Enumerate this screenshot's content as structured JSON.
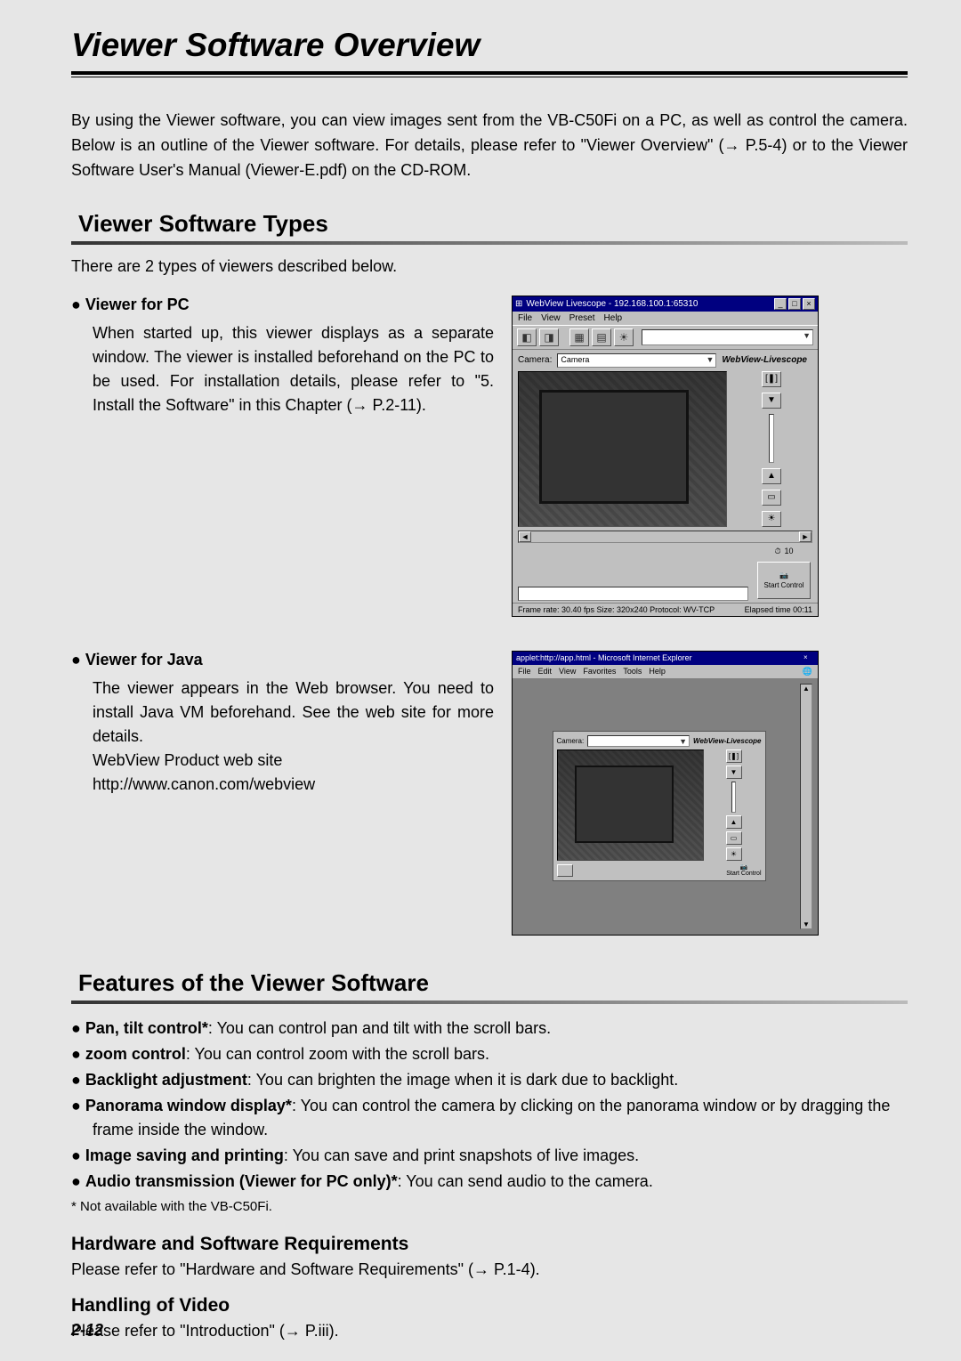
{
  "title": "Viewer Software Overview",
  "intro": "By using the Viewer software, you can view images sent from the VB-C50Fi on a PC, as well as control the camera. Below is an outline of the Viewer software. For details, please refer to \"Viewer Overview\" (→ P.5-4) or to the Viewer Software User's Manual (Viewer-E.pdf) on the CD-ROM.",
  "section_types": "Viewer Software Types",
  "types_intro": "There are 2 types of viewers described below.",
  "viewer_pc": {
    "head": "Viewer for PC",
    "body": "When started up, this viewer displays as a separate window. The viewer is installed beforehand on the PC to be used. For installation details, please refer to \"5. Install the Software\" in this Chapter (→ P.2-11)."
  },
  "viewer_java": {
    "head": "Viewer for Java",
    "body": "The viewer appears in the Web browser. You need to install Java VM beforehand. See the web site for more details.",
    "site_label": "WebView Product web site",
    "site_url": "http://www.canon.com/webview"
  },
  "pc_app": {
    "title": "WebView Livescope - 192.168.100.1:65310",
    "menu": [
      "File",
      "View",
      "Preset",
      "Help"
    ],
    "camera_label": "Camera:",
    "camera_value": "Camera",
    "brand": "WebView-Livescope",
    "status_left": "Frame rate: 30.40 fps   Size: 320x240   Protocol: WV-TCP",
    "status_right": "Elapsed time 00:11",
    "start": "Start Control"
  },
  "java_app": {
    "title": "applet:http://app.html - Microsoft Internet Explorer",
    "menu": [
      "File",
      "Edit",
      "View",
      "Favorites",
      "Tools",
      "Help"
    ],
    "camera_label": "Camera:",
    "brand": "WebView-Livescope",
    "start": "Start Control"
  },
  "section_features": "Features of the Viewer Software",
  "features": [
    {
      "b": "Pan, tilt control*",
      "t": ": You can control pan and tilt with the scroll bars."
    },
    {
      "b": "zoom control",
      "t": ": You can control zoom with the scroll bars."
    },
    {
      "b": "Backlight adjustment",
      "t": ": You can brighten the image when it is dark due to backlight."
    },
    {
      "b": "Panorama window display*",
      "t": ": You can control the camera by clicking on the panorama window or by dragging the frame inside the window."
    },
    {
      "b": "Image saving and printing",
      "t": ": You can save and print snapshots of live images."
    },
    {
      "b": "Audio transmission (Viewer for PC only)*",
      "t": ": You can send audio to the camera."
    }
  ],
  "footnote": "* Not available with the VB-C50Fi.",
  "sub_hw": {
    "head": "Hardware and Software Requirements",
    "body": "Please refer to \"Hardware and Software Requirements\" (→ P.1-4)."
  },
  "sub_video": {
    "head": "Handling of Video",
    "body": "Please refer to \"Introduction\" (→ P.iii)."
  },
  "page_number": "2-12"
}
